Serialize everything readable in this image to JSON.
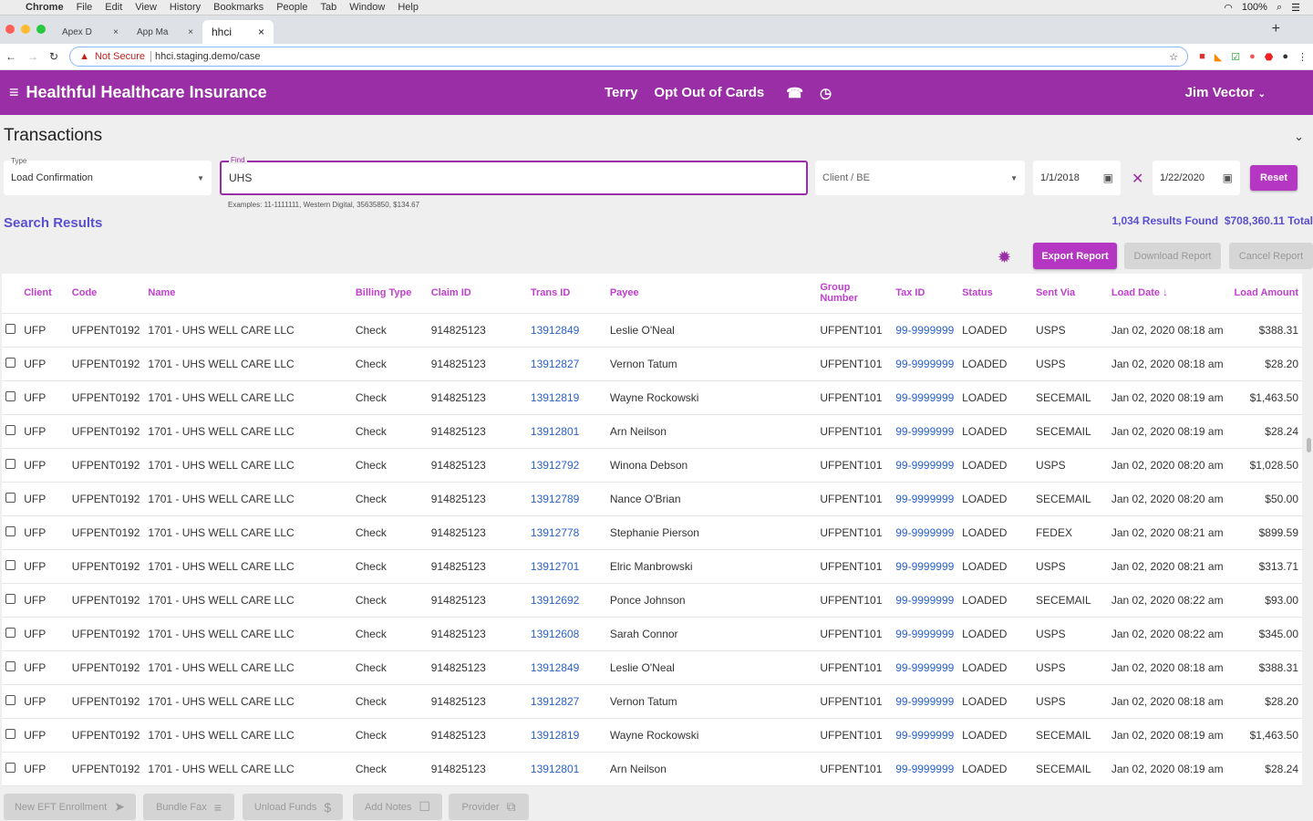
{
  "menubar": {
    "app": "Chrome",
    "items": [
      "File",
      "Edit",
      "View",
      "History",
      "Bookmarks",
      "People",
      "Tab",
      "Window",
      "Help"
    ],
    "battery": "100%"
  },
  "browser": {
    "tabs": [
      {
        "label": "Apex D"
      },
      {
        "label": "App Ma"
      },
      {
        "label": "hhci"
      }
    ],
    "security": "Not Secure",
    "url": "hhci.staging.demo/case"
  },
  "appbar": {
    "title": "Healthful Healthcare Insurance",
    "contact": "Terry",
    "topic": "Opt Out of Cards",
    "user": "Jim Vector"
  },
  "page": {
    "title": "Transactions"
  },
  "filters": {
    "type_label": "Type",
    "type_value": "Load Confirmation",
    "find_label": "Find",
    "find_value": "UHS",
    "hint": "Examples: 11-1111111, Western Digital, 35635850, $134.67",
    "client_placeholder": "Client / BE",
    "date_from": "1/1/2018",
    "date_to": "1/22/2020",
    "reset": "Reset"
  },
  "results": {
    "heading": "Search Results",
    "count": "1,034 Results Found",
    "total": "$708,360.11 Total",
    "export": "Export Report",
    "download": "Download Report",
    "cancel": "Cancel Report"
  },
  "table": {
    "columns": [
      "Client",
      "Code",
      "Name",
      "Billing Type",
      "Claim ID",
      "Trans ID",
      "Payee",
      "Group Number",
      "Tax ID",
      "Status",
      "Sent Via",
      "Load Date ↓",
      "Load Amount"
    ],
    "rows": [
      [
        "UFP",
        "UFPENT0192",
        "1701 - UHS WELL CARE LLC",
        "Check",
        "914825123",
        "13912849",
        "Leslie O'Neal",
        "UFPENT101",
        "99-9999999",
        "LOADED",
        "USPS",
        "Jan 02, 2020 08:18 am",
        "$388.31"
      ],
      [
        "UFP",
        "UFPENT0192",
        "1701 - UHS WELL CARE LLC",
        "Check",
        "914825123",
        "13912827",
        "Vernon Tatum",
        "UFPENT101",
        "99-9999999",
        "LOADED",
        "USPS",
        "Jan 02, 2020 08:18 am",
        "$28.20"
      ],
      [
        "UFP",
        "UFPENT0192",
        "1701 - UHS WELL CARE LLC",
        "Check",
        "914825123",
        "13912819",
        "Wayne Rockowski",
        "UFPENT101",
        "99-9999999",
        "LOADED",
        "SECEMAIL",
        "Jan 02, 2020 08:19 am",
        "$1,463.50"
      ],
      [
        "UFP",
        "UFPENT0192",
        "1701 - UHS WELL CARE LLC",
        "Check",
        "914825123",
        "13912801",
        "Arn Neilson",
        "UFPENT101",
        "99-9999999",
        "LOADED",
        "SECEMAIL",
        "Jan 02, 2020 08:19 am",
        "$28.24"
      ],
      [
        "UFP",
        "UFPENT0192",
        "1701 - UHS WELL CARE LLC",
        "Check",
        "914825123",
        "13912792",
        "Winona Debson",
        "UFPENT101",
        "99-9999999",
        "LOADED",
        "USPS",
        "Jan 02, 2020 08:20 am",
        "$1,028.50"
      ],
      [
        "UFP",
        "UFPENT0192",
        "1701 - UHS WELL CARE LLC",
        "Check",
        "914825123",
        "13912789",
        "Nance O'Brian",
        "UFPENT101",
        "99-9999999",
        "LOADED",
        "SECEMAIL",
        "Jan 02, 2020 08:20 am",
        "$50.00"
      ],
      [
        "UFP",
        "UFPENT0192",
        "1701 - UHS WELL CARE LLC",
        "Check",
        "914825123",
        "13912778",
        "Stephanie Pierson",
        "UFPENT101",
        "99-9999999",
        "LOADED",
        "FEDEX",
        "Jan 02, 2020 08:21 am",
        "$899.59"
      ],
      [
        "UFP",
        "UFPENT0192",
        "1701 - UHS WELL CARE LLC",
        "Check",
        "914825123",
        "13912701",
        "Elric Manbrowski",
        "UFPENT101",
        "99-9999999",
        "LOADED",
        "USPS",
        "Jan 02, 2020 08:21 am",
        "$313.71"
      ],
      [
        "UFP",
        "UFPENT0192",
        "1701 - UHS WELL CARE LLC",
        "Check",
        "914825123",
        "13912692",
        "Ponce Johnson",
        "UFPENT101",
        "99-9999999",
        "LOADED",
        "SECEMAIL",
        "Jan 02, 2020 08:22 am",
        "$93.00"
      ],
      [
        "UFP",
        "UFPENT0192",
        "1701 - UHS WELL CARE LLC",
        "Check",
        "914825123",
        "13912608",
        "Sarah Connor",
        "UFPENT101",
        "99-9999999",
        "LOADED",
        "USPS",
        "Jan 02, 2020 08:22 am",
        "$345.00"
      ],
      [
        "UFP",
        "UFPENT0192",
        "1701 - UHS WELL CARE LLC",
        "Check",
        "914825123",
        "13912849",
        "Leslie O'Neal",
        "UFPENT101",
        "99-9999999",
        "LOADED",
        "USPS",
        "Jan 02, 2020 08:18 am",
        "$388.31"
      ],
      [
        "UFP",
        "UFPENT0192",
        "1701 - UHS WELL CARE LLC",
        "Check",
        "914825123",
        "13912827",
        "Vernon Tatum",
        "UFPENT101",
        "99-9999999",
        "LOADED",
        "USPS",
        "Jan 02, 2020 08:18 am",
        "$28.20"
      ],
      [
        "UFP",
        "UFPENT0192",
        "1701 - UHS WELL CARE LLC",
        "Check",
        "914825123",
        "13912819",
        "Wayne Rockowski",
        "UFPENT101",
        "99-9999999",
        "LOADED",
        "SECEMAIL",
        "Jan 02, 2020 08:19 am",
        "$1,463.50"
      ],
      [
        "UFP",
        "UFPENT0192",
        "1701 - UHS WELL CARE LLC",
        "Check",
        "914825123",
        "13912801",
        "Arn Neilson",
        "UFPENT101",
        "99-9999999",
        "LOADED",
        "SECEMAIL",
        "Jan 02, 2020 08:19 am",
        "$28.24"
      ]
    ]
  },
  "actions": [
    {
      "label": "New EFT Enrollment",
      "icon": "send-icon",
      "glyph": "➤"
    },
    {
      "label": "Bundle Fax",
      "icon": "playlist-icon",
      "glyph": "≡"
    },
    {
      "label": "Unload Funds",
      "icon": "money-off-icon",
      "glyph": "$"
    },
    {
      "label": "Add Notes",
      "icon": "comment-icon",
      "glyph": "☐"
    },
    {
      "label": "Provider",
      "icon": "open-in-new-icon",
      "glyph": "⧉"
    }
  ],
  "colors": {
    "brand": "#9a2ea6",
    "button": "#b536c2",
    "link": "#2a62c9",
    "results": "#5a4fcf"
  }
}
